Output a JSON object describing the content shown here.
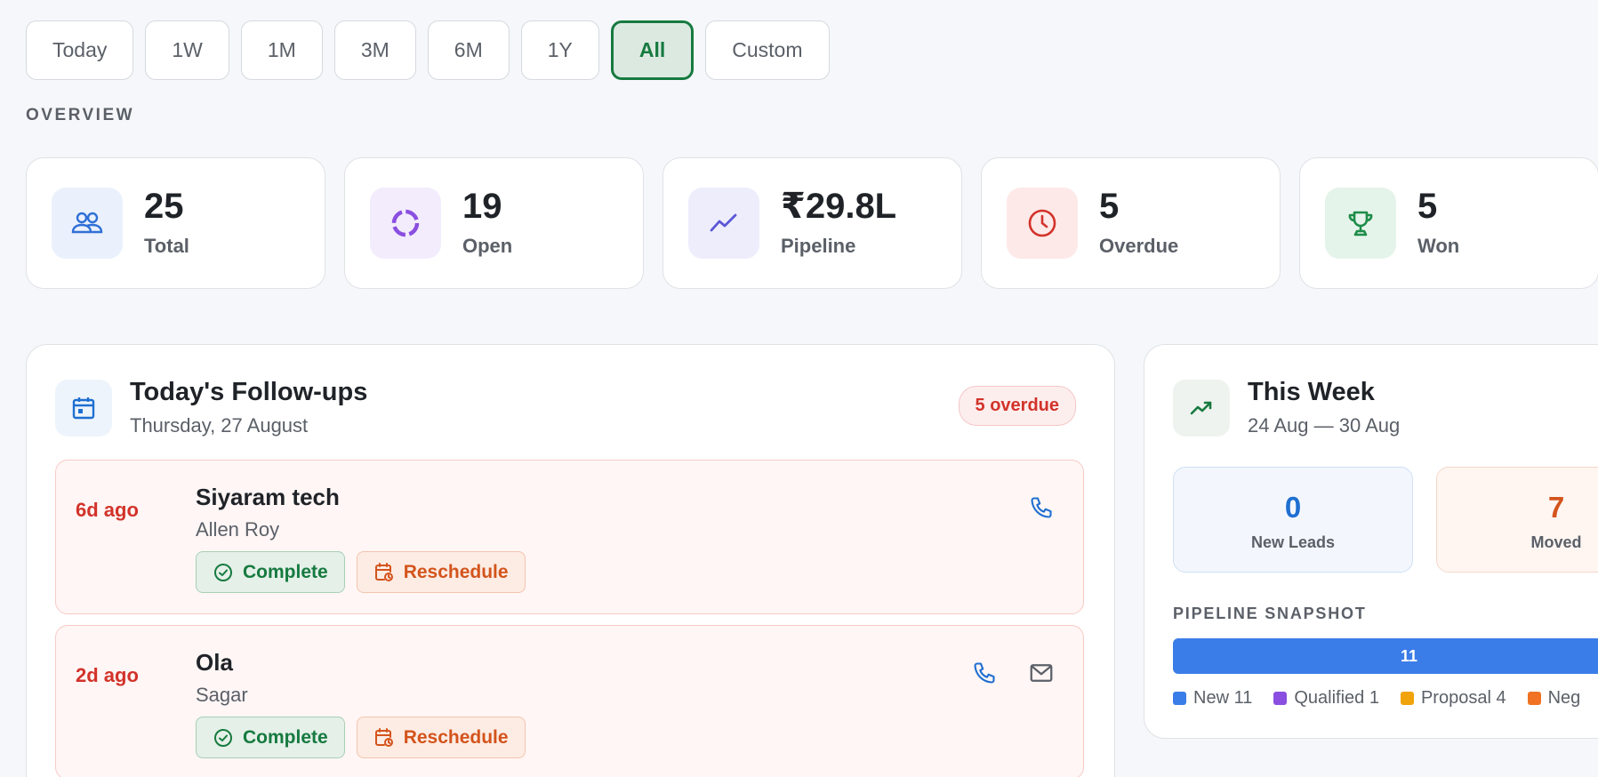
{
  "filters": [
    {
      "label": "Today",
      "active": false
    },
    {
      "label": "1W",
      "active": false
    },
    {
      "label": "1M",
      "active": false
    },
    {
      "label": "3M",
      "active": false
    },
    {
      "label": "6M",
      "active": false
    },
    {
      "label": "1Y",
      "active": false
    },
    {
      "label": "All",
      "active": true
    },
    {
      "label": "Custom",
      "active": false
    }
  ],
  "overview": {
    "section_label": "OVERVIEW",
    "stats": [
      {
        "value": "25",
        "label": "Total",
        "icon": "users-icon",
        "accent": "#2f6fd6",
        "bg": "#eaf1fc"
      },
      {
        "value": "19",
        "label": "Open",
        "icon": "progress-ring-icon",
        "accent": "#8a4fe0",
        "bg": "#f3ecfd"
      },
      {
        "value": "₹29.8L",
        "label": "Pipeline",
        "icon": "trend-line-icon",
        "accent": "#5b57d6",
        "bg": "#eeedfc"
      },
      {
        "value": "5",
        "label": "Overdue",
        "icon": "clock-icon",
        "accent": "#d2332a",
        "bg": "#fde9e8"
      },
      {
        "value": "5",
        "label": "Won",
        "icon": "trophy-icon",
        "accent": "#1d8c49",
        "bg": "#e5f4ea"
      }
    ]
  },
  "followups": {
    "title": "Today's Follow-ups",
    "date": "Thursday, 27 August",
    "overdue_badge": "5 overdue",
    "items": [
      {
        "ago": "6d ago",
        "company": "Siyaram tech",
        "contact": "Allen Roy",
        "complete_label": "Complete",
        "reschedule_label": "Reschedule",
        "has_email": false
      },
      {
        "ago": "2d ago",
        "company": "Ola",
        "contact": "Sagar",
        "complete_label": "Complete",
        "reschedule_label": "Reschedule",
        "has_email": true
      }
    ]
  },
  "week": {
    "title": "This Week",
    "range": "24 Aug — 30 Aug",
    "kpis": [
      {
        "value": "0",
        "label": "New Leads"
      },
      {
        "value": "7",
        "label": "Moved"
      }
    ],
    "snapshot_label": "PIPELINE SNAPSHOT",
    "bar_value": "11",
    "legend": [
      {
        "label": "New 11",
        "color": "#3b7de8"
      },
      {
        "label": "Qualified 1",
        "color": "#8a4fe0"
      },
      {
        "label": "Proposal 4",
        "color": "#f0a30a"
      },
      {
        "label": "Neg",
        "color": "#f07222"
      }
    ]
  },
  "colors": {
    "brand_green": "#167a3f",
    "danger": "#d2332a",
    "orange": "#d3541c",
    "link_blue": "#1f6fd1"
  }
}
